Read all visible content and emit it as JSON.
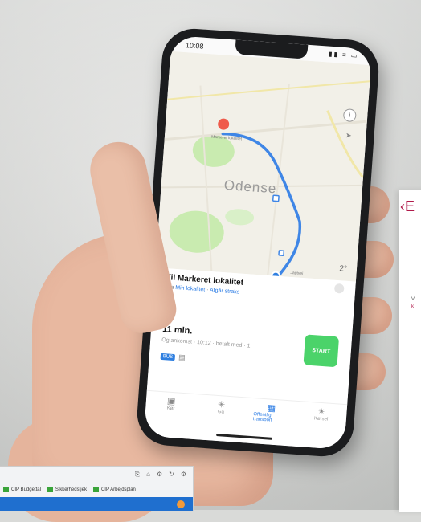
{
  "phone": {
    "status_time": "10:08",
    "status_icons": "▮▮ ≡ ▭",
    "map": {
      "city": "Odense",
      "info_icon": "i",
      "location_icon": "➤",
      "temperature": "2°",
      "labels": [
        "Markeret lokalitet",
        "Jagtvej"
      ]
    },
    "sheet": {
      "title": "Til Markeret lokalitet",
      "subtitle_prefix": "Fra",
      "subtitle_from": "Min lokalitet",
      "subtitle_sep": "·",
      "subtitle_action": "Afgår straks",
      "route_time": "11 min.",
      "route_detail": "Og ankomst · 10:12 · betalt med · 1",
      "mode_chip": "BUS",
      "start_label": "START"
    },
    "tabs": [
      {
        "label": "Kør",
        "icon": "car-icon"
      },
      {
        "label": "Gå",
        "icon": "walk-icon"
      },
      {
        "label": "Offentlig transport",
        "icon": "transit-icon",
        "active": true
      },
      {
        "label": "Kørsel",
        "icon": "ride-icon"
      }
    ]
  },
  "right_panel": {
    "back_glyph": "‹E",
    "text_line1": "V",
    "text_line2": "k"
  },
  "browser": {
    "bookmarks": [
      "CIP Budgettal",
      "Sikkerhedstjek",
      "CIP Arbejdsplan"
    ],
    "toolbar_icons": [
      "⎘",
      "⌂",
      "⚙",
      "↻",
      "⚙"
    ]
  },
  "colors": {
    "accent_blue": "#2a7be4",
    "route_line": "#3f86e6",
    "start_green": "#4bd36a",
    "panel_accent": "#b01a4a",
    "banner_blue": "#1f6fcf"
  }
}
